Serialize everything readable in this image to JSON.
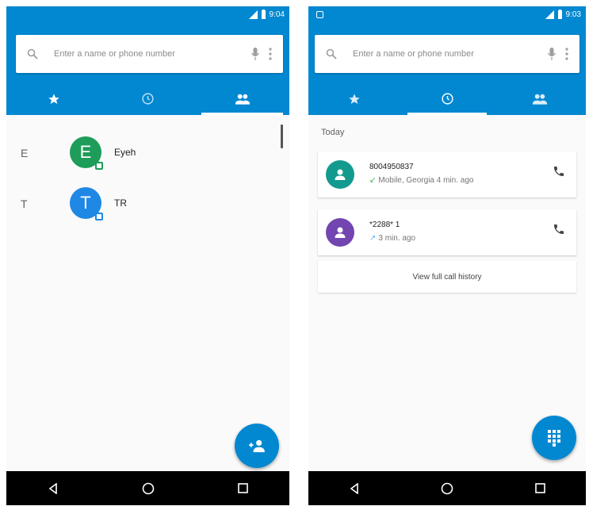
{
  "left_screen": {
    "status": {
      "time": "9:04",
      "icons": [
        "signal-icon",
        "battery-icon"
      ]
    },
    "search": {
      "placeholder": "Enter a name or phone number"
    },
    "tabs": [
      {
        "icon": "star-icon",
        "label": "Favorites"
      },
      {
        "icon": "clock-icon",
        "label": "Recents"
      },
      {
        "icon": "people-icon",
        "label": "Contacts",
        "active": true
      }
    ],
    "contacts": [
      {
        "letter": "E",
        "initial": "E",
        "name": "Eyeh",
        "color": "#1e9c5a"
      },
      {
        "letter": "T",
        "initial": "T",
        "name": "TR",
        "color": "#1f88e5"
      }
    ],
    "fab": {
      "icon": "add-contact-icon"
    }
  },
  "right_screen": {
    "status": {
      "time": "9:03",
      "icons": [
        "signal-icon",
        "battery-icon"
      ]
    },
    "search": {
      "placeholder": "Enter a name or phone number"
    },
    "tabs": [
      {
        "icon": "star-icon",
        "label": "Favorites"
      },
      {
        "icon": "clock-icon",
        "label": "Recents",
        "active": true
      },
      {
        "icon": "people-icon",
        "label": "Contacts"
      }
    ],
    "section_header": "Today",
    "calls": [
      {
        "number": "8004950837",
        "detail": "Mobile, Georgia 4 min. ago",
        "color": "#129a8f"
      },
      {
        "number": "*2288* 1",
        "detail": "3 min. ago",
        "color": "#7345b0"
      }
    ],
    "history_link": "View full call history",
    "fab": {
      "icon": "dialpad-icon"
    }
  },
  "colors": {
    "primary": "#0288d1",
    "background": "#fafafa",
    "navbar": "#000000"
  },
  "navbar": {
    "icons": [
      "back-icon",
      "home-icon",
      "recents-icon"
    ]
  }
}
